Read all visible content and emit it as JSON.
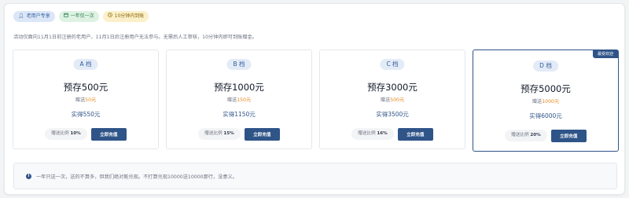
{
  "tags": [
    {
      "icon": "user-icon",
      "label": "老用户专享"
    },
    {
      "icon": "calendar-icon",
      "label": "一年仅一次"
    },
    {
      "icon": "clock-icon",
      "label": "10分钟内到账"
    }
  ],
  "notice": "活动仅面向11月1日前注册的老用户，11月1日后注册用户无法参与。无需后人工审核，10分钟内即可到账赠金。",
  "tiers": [
    {
      "grade": "A 档",
      "deposit": "预存500元",
      "bonus_label": "赠送",
      "bonus_amount": "50元",
      "get": "实得550元",
      "ratio_label": "赠送比例",
      "ratio_value": "10%",
      "button": "立即充值"
    },
    {
      "grade": "B 档",
      "deposit": "预存1000元",
      "bonus_label": "赠送",
      "bonus_amount": "150元",
      "get": "实得1150元",
      "ratio_label": "赠送比例",
      "ratio_value": "15%",
      "button": "立即充值"
    },
    {
      "grade": "C 档",
      "deposit": "预存3000元",
      "bonus_label": "赠送",
      "bonus_amount": "500元",
      "get": "实得3500元",
      "ratio_label": "赠送比例",
      "ratio_value": "16%",
      "button": "立即充值"
    },
    {
      "grade": "D 档",
      "deposit": "预存5000元",
      "bonus_label": "赠送",
      "bonus_amount": "1000元",
      "get": "实得6000元",
      "ratio_label": "赠送比例",
      "ratio_value": "20%",
      "button": "立即充值",
      "ribbon": "最受欢迎"
    }
  ],
  "info": {
    "icon": "info-icon",
    "text": "一年只送一次，送的不算多，但我们绝对能兑现。不打算兑现10000送10000那行，没意义。"
  },
  "colors": {
    "accent": "#2f5488",
    "bonus": "#e8891e"
  }
}
